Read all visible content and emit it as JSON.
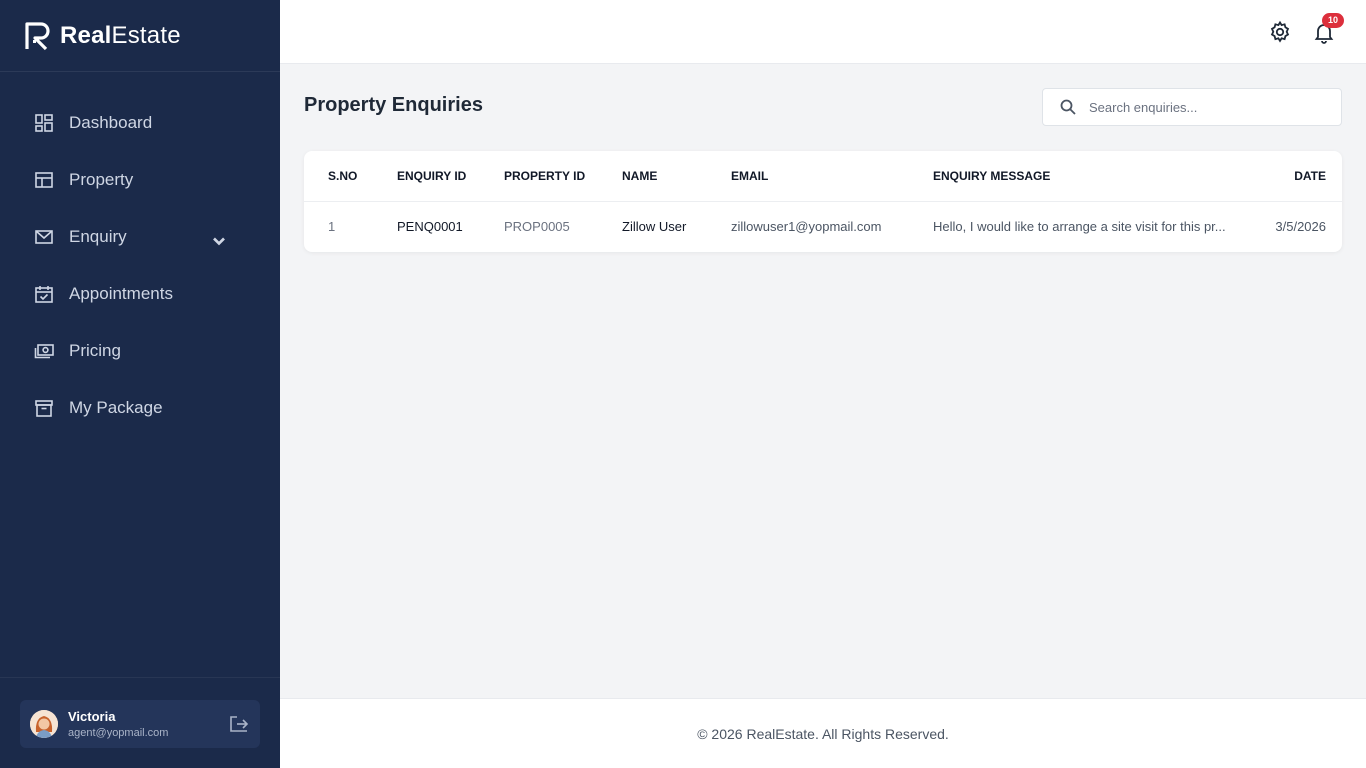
{
  "brand": {
    "bold": "Real",
    "light": "Estate"
  },
  "sidebar": {
    "items": [
      {
        "label": "Dashboard",
        "icon": "dashboard-icon"
      },
      {
        "label": "Property",
        "icon": "property-icon"
      },
      {
        "label": "Enquiry",
        "icon": "mail-icon",
        "has_submenu": true
      },
      {
        "label": "Appointments",
        "icon": "calendar-check-icon"
      },
      {
        "label": "Pricing",
        "icon": "money-icon"
      },
      {
        "label": "My Package",
        "icon": "archive-icon"
      }
    ],
    "user": {
      "name": "Victoria",
      "email": "agent@yopmail.com"
    }
  },
  "topbar": {
    "notification_count": "10"
  },
  "main": {
    "title": "Property Enquiries",
    "search": {
      "placeholder": "Search enquiries..."
    },
    "table": {
      "headers": [
        "S.NO",
        "ENQUIRY ID",
        "PROPERTY ID",
        "NAME",
        "EMAIL",
        "ENQUIRY MESSAGE",
        "DATE"
      ],
      "rows": [
        {
          "sno": "1",
          "enquiry_id": "PENQ0001",
          "property_id": "PROP0005",
          "name": "Zillow User",
          "email": "zillowuser1@yopmail.com",
          "message": "Hello, I would like to arrange a site visit for this pr...",
          "date": "3/5/2026"
        }
      ]
    }
  },
  "footer": {
    "text": "© 2026 RealEstate. All Rights Reserved."
  },
  "colors": {
    "sidebar_bg": "#1b2a4a",
    "badge": "#dc2f3c"
  }
}
